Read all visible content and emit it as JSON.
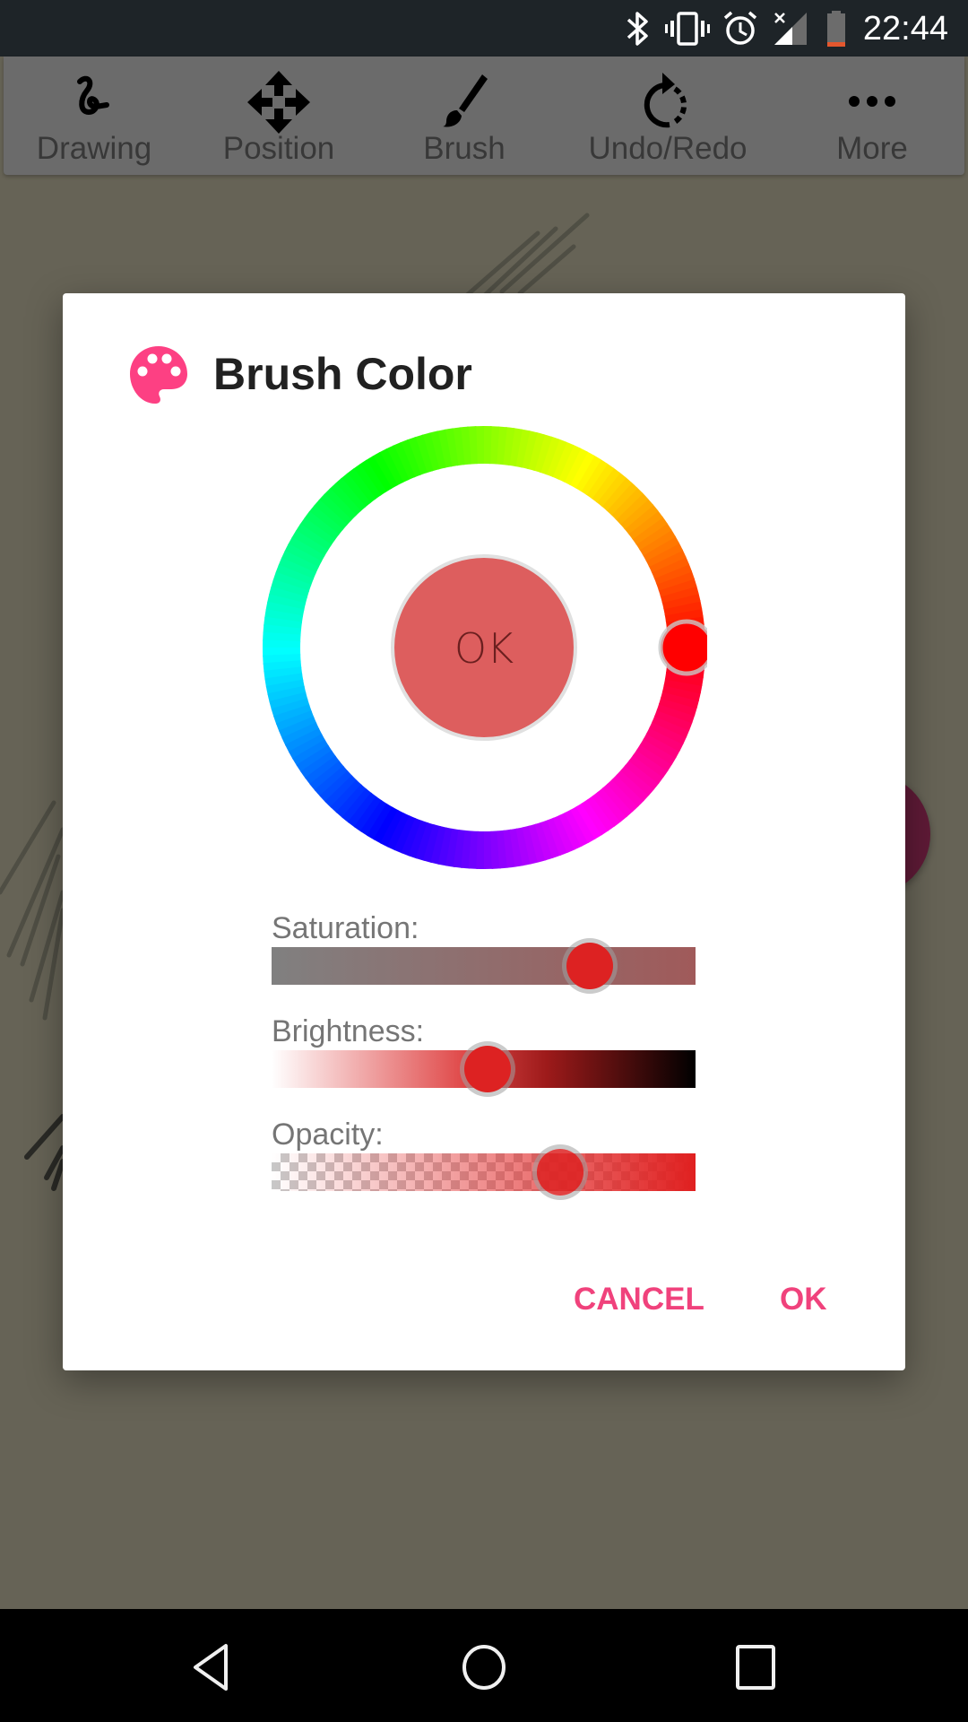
{
  "status_bar": {
    "time": "22:44",
    "icons": [
      "bluetooth-icon",
      "vibrate-icon",
      "alarm-icon",
      "signal-no-service-icon",
      "battery-low-icon"
    ]
  },
  "toolbar": {
    "items": [
      {
        "label": "Drawing",
        "icon": "drawing-squiggle-icon"
      },
      {
        "label": "Position",
        "icon": "move-arrows-icon"
      },
      {
        "label": "Brush",
        "icon": "brush-icon"
      },
      {
        "label": "Undo/Redo",
        "icon": "redo-icon"
      },
      {
        "label": "More",
        "icon": "more-dots-icon"
      }
    ]
  },
  "dialog": {
    "title": "Brush Color",
    "title_icon": "palette-icon",
    "accent_color": "#f0427c",
    "color_wheel": {
      "center_button_label": "OK",
      "selected_hue_degrees": 0,
      "preview_color": "#dd5e5e"
    },
    "sliders": [
      {
        "id": "saturation",
        "label": "Saturation:",
        "value": 0.75
      },
      {
        "id": "brightness",
        "label": "Brightness:",
        "value": 0.51
      },
      {
        "id": "opacity",
        "label": "Opacity:",
        "value": 0.68
      }
    ],
    "buttons": {
      "cancel": "CANCEL",
      "ok": "OK"
    }
  },
  "nav_bar": {
    "buttons": [
      "back-icon",
      "home-icon",
      "recents-icon"
    ]
  }
}
